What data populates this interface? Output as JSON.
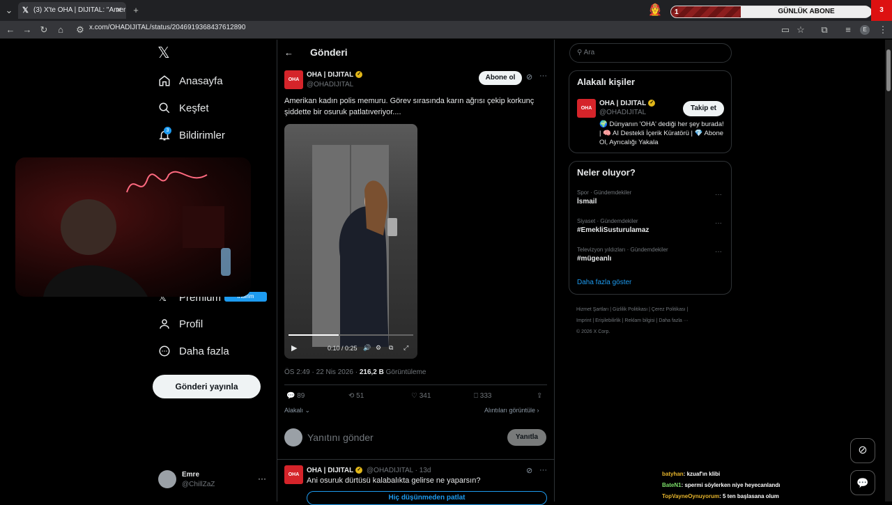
{
  "browser": {
    "tab_title": "(3) X'te OHA | DIJITAL: \"Amerika...",
    "tab_icon": "x-logo-icon",
    "url": "x.com/OHADIJITAL/status/2046919368437612890",
    "avatar_letter": "E"
  },
  "overlay": {
    "goal_count": "1",
    "goal_label": "GÜNLÜK ABONE",
    "goal_end": "3"
  },
  "nav": {
    "logo": "𝕏",
    "items": [
      "Anasayfa",
      "Keşfet",
      "Bildirimler",
      "Premium",
      "Profil",
      "Daha fazla"
    ],
    "notif_badge": "3",
    "premium_badge": "İndirim",
    "post_button": "Gönderi yayınla",
    "user_name": "Emre",
    "user_handle": "@ChillZaZ"
  },
  "header": {
    "title": "Gönderi"
  },
  "post": {
    "author": "OHA | DIJITAL",
    "handle": "@OHADIJITAL",
    "subscribe": "Abone ol",
    "text": "Amerikan kadın polis memuru. Görev sırasında karın ağrısı çekip korkunç şiddette bir osuruk patlatıveriyor....",
    "video_time": "0:10 / 0:25",
    "video_progress": 0.4,
    "time": "ÖS 2:49 · 22 Nis 2026 · ",
    "views": "216,2 B",
    "views_label": "Görüntüleme",
    "replies": "89",
    "reposts": "51",
    "likes": "341",
    "bookmarks": "333",
    "relevant": "Alakalı",
    "quotes": "Alıntıları görüntüle",
    "reply_placeholder": "Yanıtını gönder",
    "reply_button": "Yanıtla"
  },
  "reply_post": {
    "author": "OHA | DIJITAL",
    "handle": "@OHADIJITAL · 13d",
    "text": "Ani osuruk dürtüsü kalabalıkta gelirse ne yaparsın?",
    "poll_option": "Hiç düşünmeden patlat"
  },
  "search": {
    "placeholder": "Ara"
  },
  "related": {
    "title": "Alakalı kişiler",
    "name": "OHA | DIJITAL",
    "handle": "@OHADIJITAL",
    "follow": "Takip et",
    "bio": "🌍 Dünyanın 'OHA' dediği her şey burada! | 🧠 AI Destekli İçerik Küratörü | 💎 Abone Ol, Ayrıcalığı Yakala"
  },
  "trends": {
    "title": "Neler oluyor?",
    "items": [
      {
        "cat": "Spor · Gündemdekiler",
        "name": "İsmail"
      },
      {
        "cat": "Siyaset · Gündemdekiler",
        "name": "#EmekliSusturulamaz"
      },
      {
        "cat": "Televizyon yıldızları · Gündemdekiler",
        "name": "#mügeanlı"
      }
    ],
    "more": "Daha fazla göster"
  },
  "footer": {
    "line1": [
      "Hizmet Şartları",
      "Gizlilik Politikası",
      "Çerez Politikası"
    ],
    "line2": [
      "Imprint",
      "Erişilebilirlik",
      "Reklam bilgisi",
      "Daha fazla ···"
    ],
    "copyright": "© 2026 X Corp."
  },
  "chat": [
    {
      "user": "batyhan",
      "msg": "kzuaf'ın klibi",
      "color": "#e8b62c"
    },
    {
      "user": "BateN1",
      "msg": "spermi söylerken niye heyecanlandı",
      "color": "#7de06a"
    },
    {
      "user": "TopVayneOynuyorum",
      "msg": "5 ten başlasana olum",
      "color": "#e8b62c"
    }
  ],
  "colors": {
    "accent": "#1d9bf0",
    "brand": "#d5242a"
  }
}
